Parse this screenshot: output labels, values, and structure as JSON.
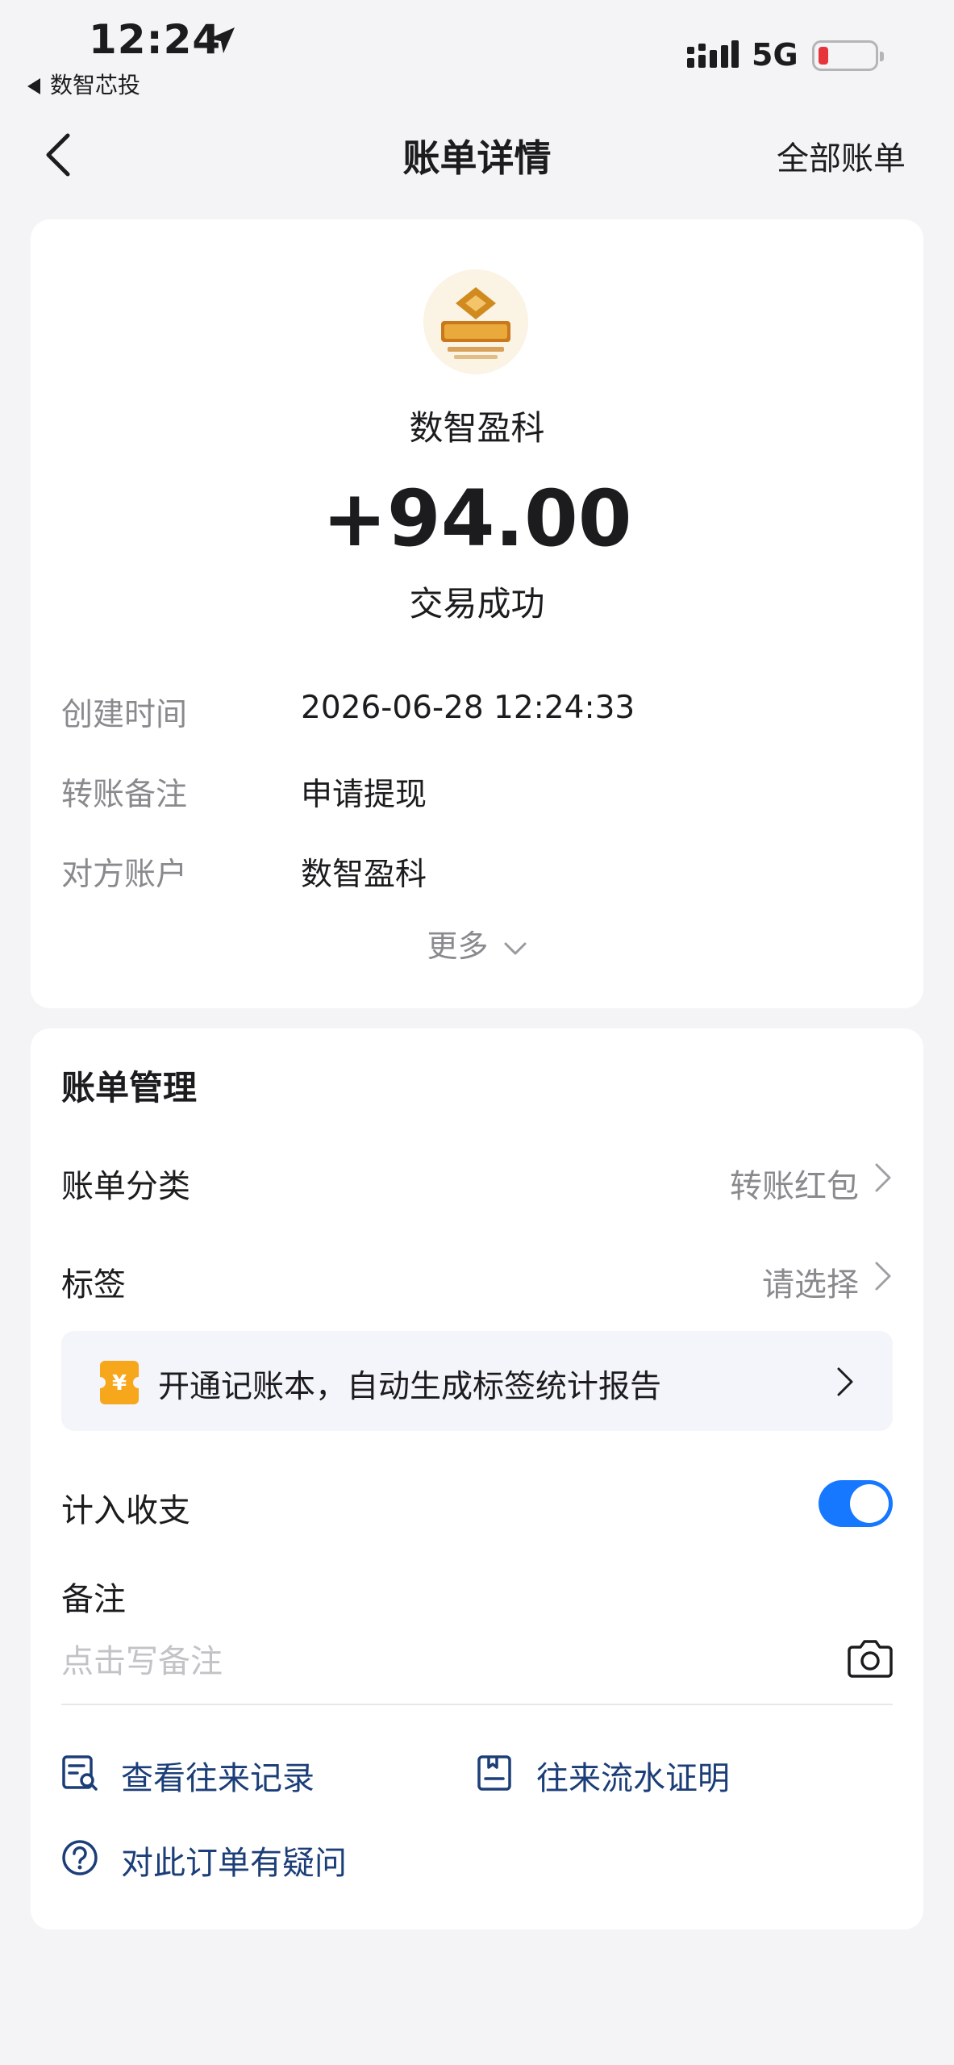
{
  "status_bar": {
    "time": "12:24",
    "back_app": "数智芯投",
    "network": "5G"
  },
  "nav": {
    "title": "账单详情",
    "right_label": "全部账单"
  },
  "summary": {
    "merchant_name": "数智盈科",
    "amount": "+94.00",
    "status": "交易成功",
    "rows": [
      {
        "label": "创建时间",
        "value": "2026-06-28 12:24:33"
      },
      {
        "label": "转账备注",
        "value": "申请提现"
      },
      {
        "label": "对方账户",
        "value": "数智盈科"
      }
    ],
    "more_label": "更多"
  },
  "management": {
    "title": "账单管理",
    "category_label": "账单分类",
    "category_value": "转账红包",
    "tag_label": "标签",
    "tag_value": "请选择",
    "promo_text": "开通记账本，自动生成标签统计报告",
    "include_label": "计入收支",
    "include_enabled": true,
    "note_label": "备注",
    "note_placeholder": "点击写备注"
  },
  "links": {
    "records": "查看往来记录",
    "statement": "往来流水证明",
    "question": "对此订单有疑问"
  },
  "colors": {
    "accent": "#1677ff",
    "link": "#1c3e78",
    "promo_icon": "#f7a71c"
  }
}
